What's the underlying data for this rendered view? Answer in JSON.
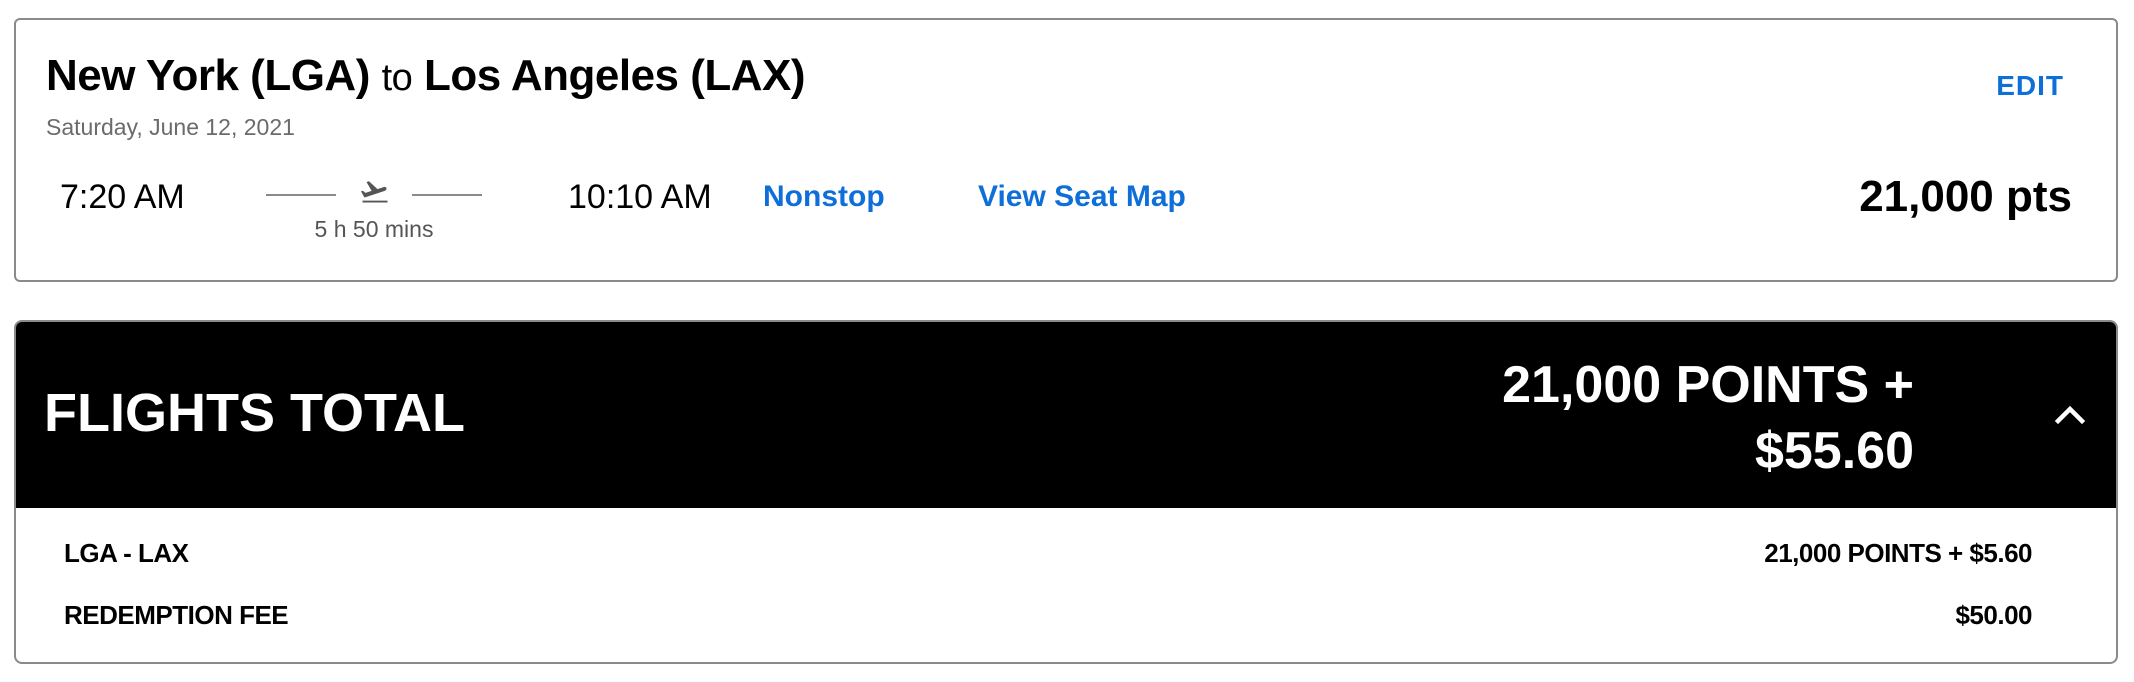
{
  "flight": {
    "origin": "New York (LGA)",
    "connector": "to",
    "destination": "Los Angeles (LAX)",
    "date": "Saturday, June 12, 2021",
    "edit_label": "EDIT",
    "depart_time": "7:20 AM",
    "duration": "5 h 50 mins",
    "arrive_time": "10:10 AM",
    "stops_label": "Nonstop",
    "seat_map_label": "View Seat Map",
    "price": "21,000 pts"
  },
  "total": {
    "label": "FLIGHTS TOTAL",
    "amount_line1": "21,000 POINTS +",
    "amount_line2": "$55.60",
    "toggle_icon": "chevron-up-icon",
    "rows": [
      {
        "label": "LGA - LAX",
        "value": "21,000 POINTS + $5.60"
      },
      {
        "label": "REDEMPTION FEE",
        "value": "$50.00"
      }
    ]
  },
  "colors": {
    "link": "#0e6fd8",
    "header_bg": "#000000",
    "border": "#8a8a8a",
    "muted_text": "#6b6b6b"
  }
}
